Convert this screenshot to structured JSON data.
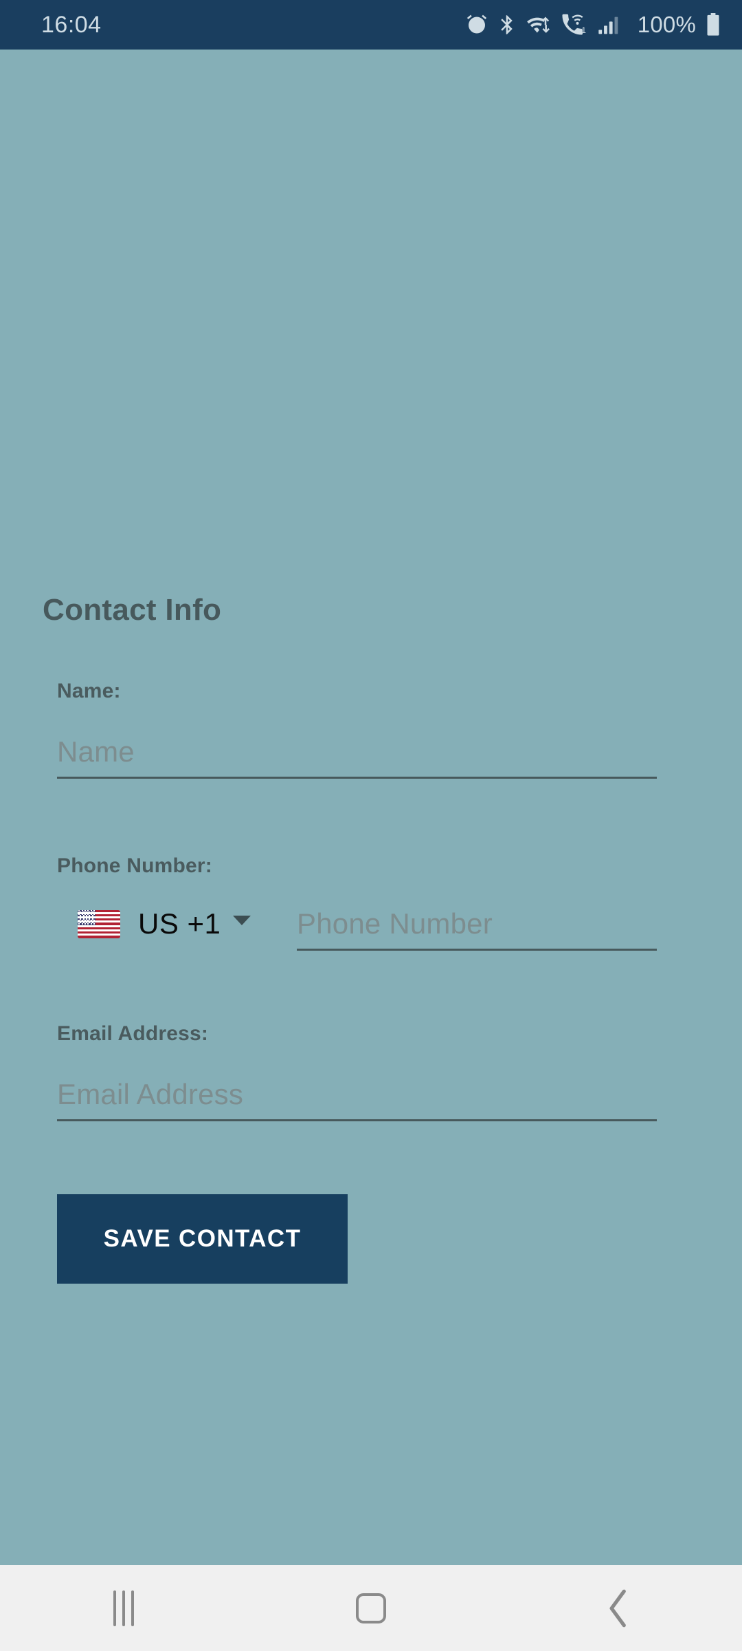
{
  "status_bar": {
    "clock": "16:04",
    "battery_percent": "100%",
    "icons": [
      "alarm-icon",
      "bluetooth-icon",
      "wifi-icon",
      "vowifi-call-icon",
      "signal-bars-icon",
      "battery-icon"
    ],
    "sim_label": "1",
    "background_color": "#1A3E5F",
    "foreground_color": "#CFDCE4"
  },
  "screen": {
    "background_color": "#85AFB7",
    "title": "Contact Info"
  },
  "form": {
    "name": {
      "label": "Name:",
      "placeholder": "Name",
      "value": ""
    },
    "phone": {
      "label": "Phone Number:",
      "country_flag": "us-flag-icon",
      "country_code_label": "US  +1",
      "country_iso": "US",
      "dial_code": "+1",
      "placeholder": "Phone Number",
      "value": ""
    },
    "email": {
      "label": "Email Address:",
      "placeholder": "Email Address",
      "value": ""
    },
    "submit": {
      "label": "SAVE CONTACT",
      "background_color": "#173F5F",
      "text_color": "#FFFFFF"
    }
  },
  "nav_bar": {
    "background_color": "#F0F0F0",
    "buttons": [
      {
        "name": "recents",
        "icon": "recents-icon"
      },
      {
        "name": "home",
        "icon": "home-icon"
      },
      {
        "name": "back",
        "icon": "back-chevron-icon"
      }
    ]
  }
}
